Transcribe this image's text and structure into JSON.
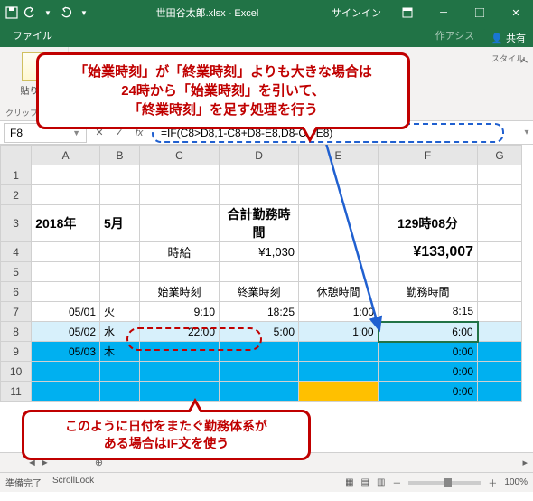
{
  "title": "世田谷太郎.xlsx - Excel",
  "signin": "サインイン",
  "tabs": {
    "file": "ファイル",
    "assist": "作アシス",
    "share": "共有"
  },
  "ribbon": {
    "paste": "貼り付",
    "clipboard": "クリップボード",
    "style": "スタイル"
  },
  "callout1": {
    "l1": "「始業時刻」が「終業時刻」よりも大きな場合は",
    "l2": "24時から「始業時刻」を引いて、",
    "l3": "「終業時刻」を足す処理を行う"
  },
  "callout2": {
    "l1": "このように日付をまたぐ勤務体系が",
    "l2": "ある場合はIF文を使う"
  },
  "namebox": "F8",
  "fx_label": "fx",
  "formula": "=IF(C8>D8,1-C8+D8-E8,D8-C8-E8)",
  "cols": [
    "A",
    "B",
    "C",
    "D",
    "E",
    "F",
    "G"
  ],
  "rows": {
    "3": {
      "A": "2018年",
      "B": "5月",
      "D": "合計勤務時間",
      "F": "129時08分"
    },
    "4": {
      "C": "時給",
      "D": "¥1,030",
      "F": "¥133,007"
    },
    "6": {
      "C": "始業時刻",
      "D": "終業時刻",
      "E": "休憩時間",
      "F": "勤務時間"
    },
    "7": {
      "A": "05/01",
      "B": "火",
      "C": "9:10",
      "D": "18:25",
      "E": "1:00",
      "F": "8:15"
    },
    "8": {
      "A": "05/02",
      "B": "水",
      "C": "22:00",
      "D": "5:00",
      "E": "1:00",
      "F": "6:00"
    },
    "9": {
      "A": "05/03",
      "B": "木",
      "F": "0:00"
    },
    "10": {
      "F": "0:00"
    },
    "11": {
      "F": "0:00"
    }
  },
  "status": {
    "ready": "準備完了",
    "scroll": "ScrollLock",
    "zoom": "100%"
  }
}
